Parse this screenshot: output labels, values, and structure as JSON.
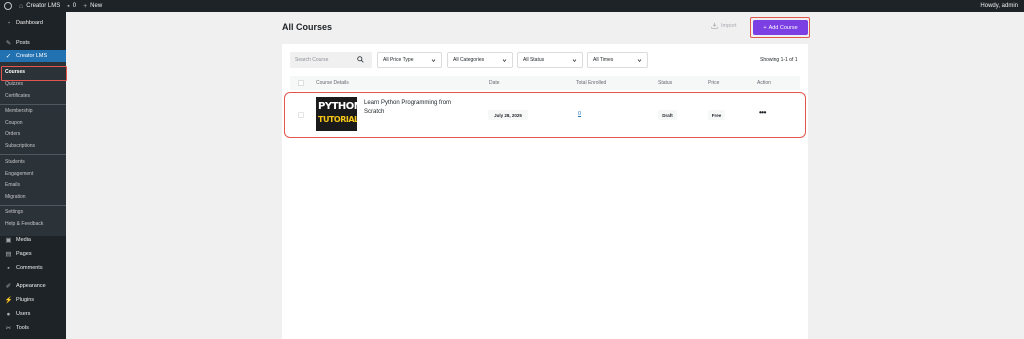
{
  "adminbar": {
    "site_name": "Creator LMS",
    "comments_count": "0",
    "new_label": "New",
    "howdy": "Howdy, admin"
  },
  "sidebar": {
    "dashboard": "Dashboard",
    "posts": "Posts",
    "creator_lms": "Creator LMS",
    "submenu": [
      "Courses",
      "Quizzes",
      "Certificates",
      "Membership",
      "Coupon",
      "Orders",
      "Subscriptions",
      "Students",
      "Engagement",
      "Emails",
      "Migration",
      "Settings",
      "Help & Feedback"
    ],
    "media": "Media",
    "pages": "Pages",
    "comments": "Comments",
    "appearance": "Appearance",
    "plugins": "Plugins",
    "users": "Users",
    "tools": "Tools"
  },
  "page": {
    "title": "All Courses",
    "import_label": "Import",
    "add_course_label": "Add Course"
  },
  "filters": {
    "search_placeholder": "Search Course",
    "price_type": "All Price Type",
    "categories": "All Categories",
    "status": "All Status",
    "times": "All Times",
    "showing": "Showing 1-1 of 1"
  },
  "table": {
    "headers": {
      "course_details": "Course Details",
      "date": "Date",
      "total_enrolled": "Total Enrolled",
      "status": "Status",
      "price": "Price",
      "action": "Action"
    },
    "rows": [
      {
        "thumb_line1": "PYTHON",
        "thumb_line2": "TUTORIAL",
        "title": "Learn Python Programming from Scratch",
        "date": "July 28, 2025",
        "enrolled": "0",
        "status": "Draft",
        "price": "Free",
        "action": "•••"
      }
    ]
  },
  "colors": {
    "accent": "#7b3fe4",
    "wp_blue": "#2271b1",
    "highlight": "#e2564d",
    "admin_dark": "#1d2327"
  }
}
